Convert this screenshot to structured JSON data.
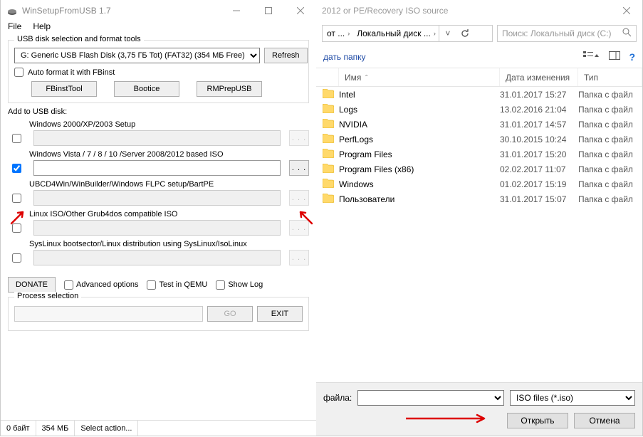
{
  "left": {
    "title": "WinSetupFromUSB 1.7",
    "menu": {
      "file": "File",
      "help": "Help"
    },
    "group1_legend": "USB disk selection and format tools",
    "disk_select": "G: Generic USB Flash Disk (3,75 ГБ Tot) (FAT32) (354 МБ Free)",
    "refresh": "Refresh",
    "autoformat": "Auto format it with FBinst",
    "fbinst": "FBinstTool",
    "bootice": "Bootice",
    "rmprep": "RMPrepUSB",
    "add_label": "Add to USB disk:",
    "s1": "Windows 2000/XP/2003 Setup",
    "s2": "Windows Vista / 7 / 8 / 10 /Server 2008/2012 based ISO",
    "s3": "UBCD4Win/WinBuilder/Windows FLPC setup/BartPE",
    "s4": "Linux ISO/Other Grub4dos compatible ISO",
    "s5": "SysLinux bootsector/Linux distribution using SysLinux/IsoLinux",
    "browse_dots": ". . .",
    "donate": "DONATE",
    "adv": "Advanced options",
    "qemu": "Test in QEMU",
    "showlog": "Show Log",
    "proc_legend": "Process selection",
    "go": "GO",
    "exit": "EXIT",
    "status": {
      "a": "0 байт",
      "b": "354 МБ",
      "c": "Select action..."
    }
  },
  "right": {
    "title": "2012 or PE/Recovery ISO source",
    "path_a": "от ...",
    "path_b": "Локальный диск ...",
    "search_ph": "Поиск: Локальный диск (C:)",
    "newfolder": "дать папку",
    "cols": {
      "name": "Имя",
      "date": "Дата изменения",
      "type": "Тип"
    },
    "files": [
      {
        "name": "Intel",
        "date": "31.01.2017 15:27",
        "type": "Папка с файл"
      },
      {
        "name": "Logs",
        "date": "13.02.2016 21:04",
        "type": "Папка с файл"
      },
      {
        "name": "NVIDIA",
        "date": "31.01.2017 14:57",
        "type": "Папка с файл"
      },
      {
        "name": "PerfLogs",
        "date": "30.10.2015 10:24",
        "type": "Папка с файл"
      },
      {
        "name": "Program Files",
        "date": "31.01.2017 15:20",
        "type": "Папка с файл"
      },
      {
        "name": "Program Files (x86)",
        "date": "02.02.2017 11:07",
        "type": "Папка с файл"
      },
      {
        "name": "Windows",
        "date": "01.02.2017 15:19",
        "type": "Папка с файл"
      },
      {
        "name": "Пользователи",
        "date": "31.01.2017 15:07",
        "type": "Папка с файл"
      }
    ],
    "fname_lbl": "файла:",
    "filter": "ISO files (*.iso)",
    "open": "Открыть",
    "cancel": "Отмена"
  }
}
